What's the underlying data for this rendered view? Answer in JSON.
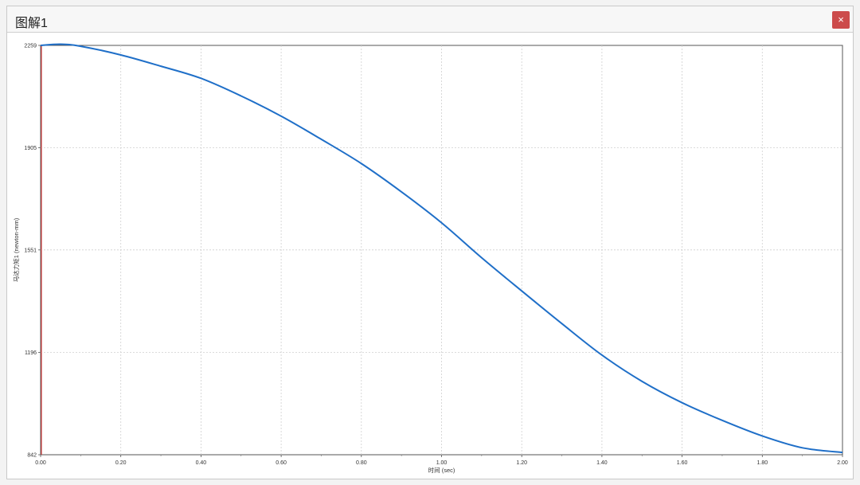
{
  "window": {
    "title": "图解1",
    "close_label": "×",
    "close_color": "#cc4b4b"
  },
  "chart_data": {
    "type": "line",
    "title": "",
    "xlabel": "时间 (sec)",
    "ylabel": "马达力矩1 (newton-mm)",
    "xlim": [
      0,
      2.0
    ],
    "ylim": [
      842,
      2259
    ],
    "x_ticks": [
      "0.00",
      "0.20",
      "0.40",
      "0.60",
      "0.80",
      "1.00",
      "1.20",
      "1.40",
      "1.60",
      "1.80",
      "2.00"
    ],
    "y_ticks": [
      "842",
      "1196",
      "1551",
      "1905",
      "2259"
    ],
    "grid": true,
    "series_color": "#1f6fc8",
    "series": [
      {
        "x": [
          0,
          0.05,
          0.1,
          0.2,
          0.3,
          0.4,
          0.5,
          0.6,
          0.7,
          0.8,
          0.9,
          1.0,
          1.1,
          1.2,
          1.3,
          1.4,
          1.5,
          1.6,
          1.7,
          1.8,
          1.9,
          2.0
        ],
        "y": [
          2259,
          2263,
          2256,
          2226,
          2187,
          2145,
          2084,
          2014,
          1934,
          1850,
          1752,
          1645,
          1524,
          1409,
          1296,
          1187,
          1096,
          1022,
          961,
          907,
          866,
          850
        ]
      }
    ]
  }
}
